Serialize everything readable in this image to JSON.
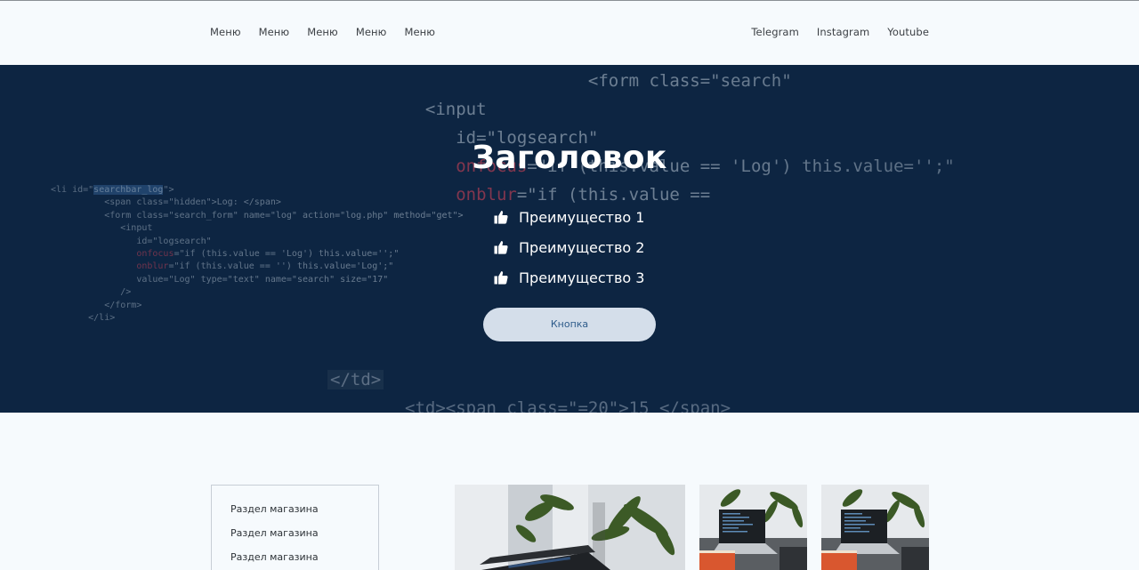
{
  "header": {
    "menu": [
      "Меню",
      "Меню",
      "Меню",
      "Меню",
      "Меню"
    ],
    "social": [
      "Telegram",
      "Instagram",
      "Youtube"
    ]
  },
  "hero": {
    "title": "Заголовок",
    "benefits": [
      "Преимущество 1",
      "Преимущество 2",
      "Преимущество 3"
    ],
    "button_label": "Кнопка",
    "icon": "thumbs-up-icon",
    "background_color": "#0d2542"
  },
  "shop": {
    "sections": [
      "Раздел магазина",
      "Раздел магазина",
      "Раздел магазина"
    ]
  }
}
